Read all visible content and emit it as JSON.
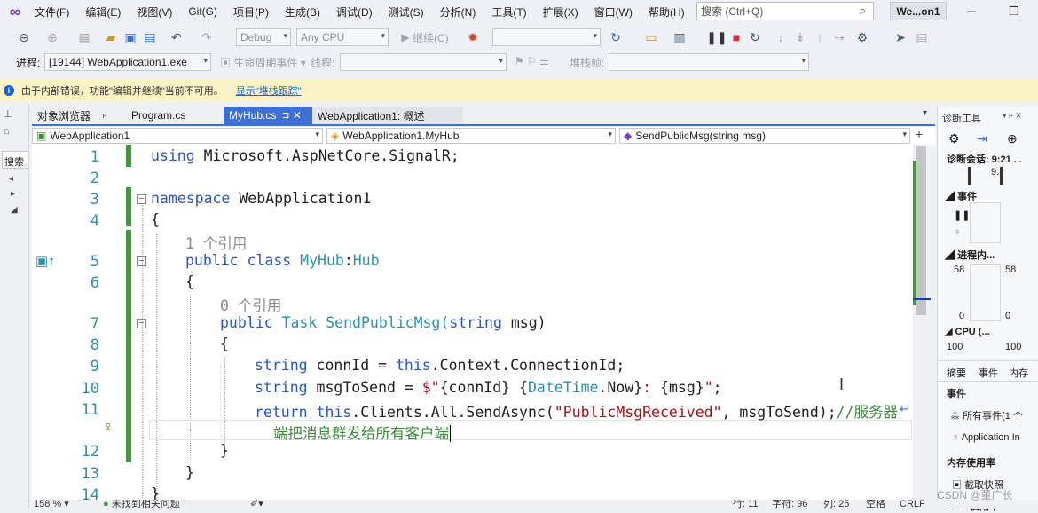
{
  "menu": [
    "文件(F)",
    "编辑(E)",
    "视图(V)",
    "Git(G)",
    "项目(P)",
    "生成(B)",
    "调试(D)",
    "测试(S)",
    "分析(N)",
    "工具(T)",
    "扩展(X)",
    "窗口(W)",
    "帮助(H)"
  ],
  "search_placeholder": "搜索 (Ctrl+Q)",
  "window_title": "We...on1",
  "toolbar": {
    "config": "Debug",
    "platform": "Any CPU",
    "continue_label": "继续(C)"
  },
  "process_bar": {
    "process_label": "进程:",
    "process_value": "[19144] WebApplication1.exe",
    "lifecycle_label": "生命周期事件",
    "thread_label": "线程:",
    "stackframe_label": "堆栈帧:"
  },
  "infobar": {
    "message": "由于内部错误，功能\"编辑并继续\"当前不可用。",
    "link": "显示\"堆栈跟踪\""
  },
  "left_strip": {
    "search_label": "搜索"
  },
  "tabs": [
    {
      "label": "对象浏览器",
      "pin": "ᴘ"
    },
    {
      "label": "Program.cs"
    },
    {
      "label": "MyHub.cs",
      "pin": "⊐"
    },
    {
      "label": "WebApplication1: 概述"
    }
  ],
  "nav": {
    "project": "WebApplication1",
    "class": "WebApplication1.MyHub",
    "member": "SendPublicMsg(string msg)"
  },
  "code": {
    "line_numbers": [
      "1",
      "2",
      "3",
      "4",
      "5",
      "6",
      "7",
      "8",
      "9",
      "10",
      "11",
      "12",
      "13",
      "14"
    ],
    "l1_kw": "using",
    "l1_rest": " Microsoft.AspNetCore.SignalR;",
    "l3_kw": "namespace",
    "l3_rest": " WebApplication1",
    "brace_open": "{",
    "brace_close": "}",
    "ref1": "1 个引用",
    "l5_kw": "public class ",
    "l5_type": "MyHub",
    "l5_colon": ":",
    "l5_base": "Hub",
    "ref0": "0 个引用",
    "l7_kw": "public ",
    "l7_type": "Task",
    "l7_name": " SendPublicMsg(",
    "l7_kw2": "string",
    "l7_rest": " msg)",
    "l9_kw": "string",
    "l9_a": " connId = ",
    "l9_this": "this",
    "l9_b": ".Context.ConnectionId;",
    "l10_kw": "string",
    "l10_a": " msgToSend = ",
    "l10_s1": "$\"",
    "l10_i1": "{connId}",
    "l10_s2": " ",
    "l10_i2a": "{",
    "l10_i2t": "DateTime",
    "l10_i2b": ".Now}",
    "l10_s3": ": ",
    "l10_i3": "{msg}",
    "l10_s4": "\"",
    "l10_end": ";",
    "l11_kw": "return",
    "l11_sp": " ",
    "l11_this": "this",
    "l11_a": ".Clients.All.SendAsync(",
    "l11_str": "\"PublicMsgReceived\"",
    "l11_b": ", msgToSend);",
    "l11_cm": "//服务器",
    "l11_wrap": "端把消息群发给所有客户端"
  },
  "right_panel": {
    "title": "诊断工具",
    "session": "诊断会话: 9:21 ...",
    "tick": "9:",
    "events_header": "事件",
    "process_memory": "进程内...",
    "mem_max_l": "58",
    "mem_max_r": "58",
    "mem_min_l": "0",
    "mem_min_r": "0",
    "cpu": "CPU (...",
    "cpu_l": "100",
    "cpu_r": "100",
    "tabs": [
      "摘要",
      "事件",
      "内存"
    ],
    "events_section": "事件",
    "all_events": "所有事件(1 个",
    "app_insights": "Application In",
    "memory_usage": "内存使用率",
    "snapshot": "截取快照",
    "cpu_usage": "CPU 使用率"
  },
  "statusbar": {
    "zoom": "158 %",
    "issues": "未找到相关问题",
    "row": "行: 11",
    "chars": "字符: 96",
    "col": "列: 25",
    "spaces": "空格",
    "eol": "CRLF"
  },
  "watermark": "CSDN @董广长"
}
